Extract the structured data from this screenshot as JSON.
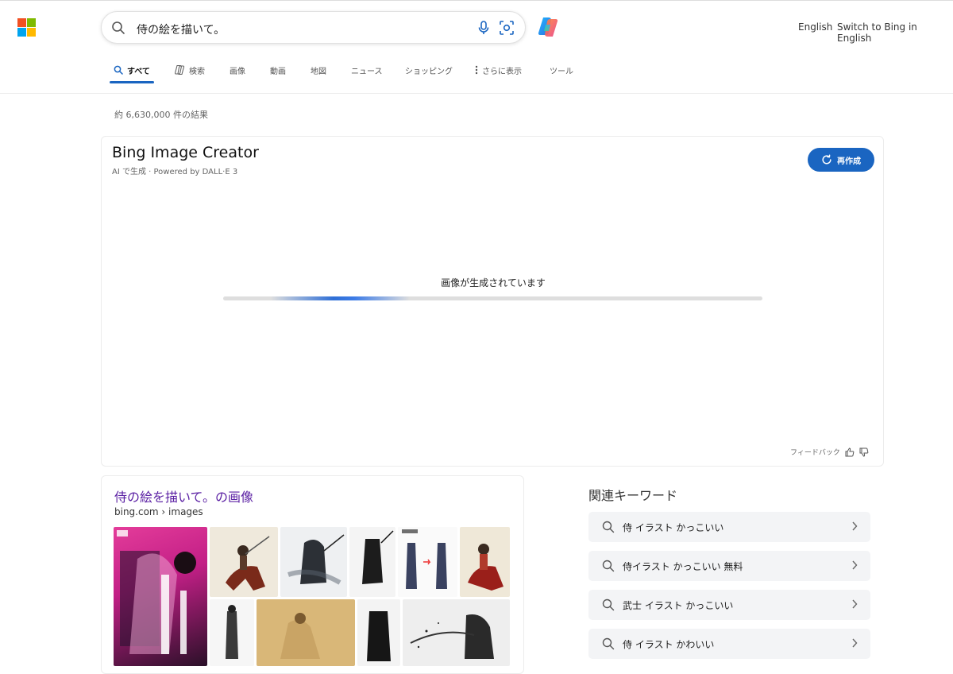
{
  "header": {
    "search_query": "侍の絵を描いて。",
    "lang_english": "English",
    "lang_switch": "Switch to Bing in English"
  },
  "nav": {
    "tabs": [
      {
        "label": "すべて",
        "icon": "search-icon",
        "active": true
      },
      {
        "label": "検索",
        "icon": "copilot-search-icon",
        "active": false
      },
      {
        "label": "画像",
        "active": false
      },
      {
        "label": "動画",
        "active": false
      },
      {
        "label": "地図",
        "active": false
      },
      {
        "label": "ニュース",
        "active": false
      },
      {
        "label": "ショッピング",
        "active": false
      },
      {
        "label": "さらに表示",
        "icon": "more-vertical-icon",
        "active": false
      },
      {
        "label": "ツール",
        "active": false
      }
    ]
  },
  "results": {
    "count": "約 6,630,000 件の結果"
  },
  "image_creator": {
    "title": "Bing Image Creator",
    "subtitle": "AI で生成 · Powered by DALL·E 3",
    "regenerate_label": "再作成",
    "status": "画像が生成されています",
    "feedback_label": "フィードバック"
  },
  "images_result": {
    "title": "侍の絵を描いて。の画像",
    "url": "bing.com › images"
  },
  "related": {
    "title": "関連キーワード",
    "items": [
      "侍 イラスト かっこいい",
      "侍イラスト かっこいい 無料",
      "武士 イラスト かっこいい",
      "侍 イラスト かわいい"
    ]
  },
  "colors": {
    "accent": "#1a65c1",
    "visited_link": "#5a1fa3"
  }
}
